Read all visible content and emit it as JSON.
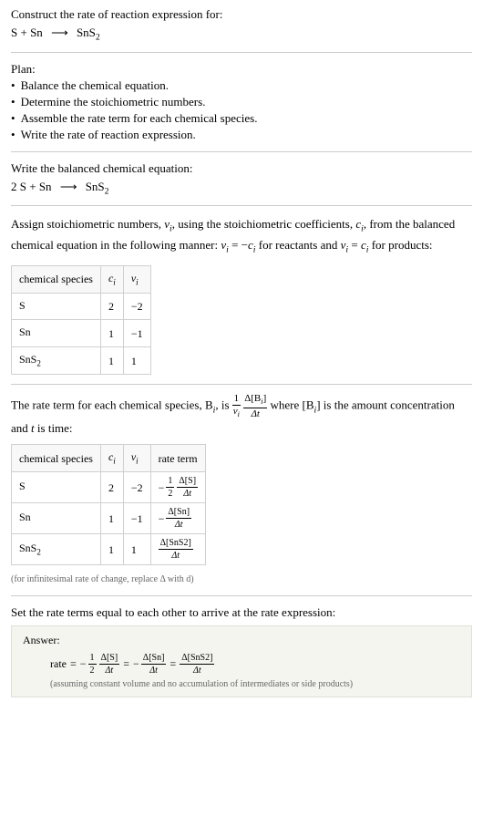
{
  "intro": {
    "line1": "Construct the rate of reaction expression for:",
    "equation_lhs1": "S",
    "equation_lhs2": "Sn",
    "equation_rhs": "SnS",
    "equation_rhs_sub": "2"
  },
  "plan": {
    "title": "Plan:",
    "items": [
      "Balance the chemical equation.",
      "Determine the stoichiometric numbers.",
      "Assemble the rate term for each chemical species.",
      "Write the rate of reaction expression."
    ]
  },
  "balanced": {
    "title": "Write the balanced chemical equation:",
    "coef1": "2",
    "sp1": "S",
    "sp2": "Sn",
    "sp3": "SnS",
    "sp3_sub": "2"
  },
  "stoich": {
    "text1": "Assign stoichiometric numbers, ",
    "nu_i": "ν",
    "sub_i": "i",
    "text2": ", using the stoichiometric coefficients, ",
    "c_i": "c",
    "text3": ", from the balanced chemical equation in the following manner: ",
    "rel1_lhs": "ν",
    "rel1_rhs_pre": " = −",
    "rel1_rhs": "c",
    "text4": " for reactants and ",
    "rel2_lhs": "ν",
    "rel2_rhs_pre": " = ",
    "rel2_rhs": "c",
    "text5": " for products:",
    "table": {
      "h1": "chemical species",
      "h2": "c",
      "h2_sub": "i",
      "h3": "ν",
      "h3_sub": "i",
      "rows": [
        {
          "sp": "S",
          "sub": "",
          "c": "2",
          "nu": "−2"
        },
        {
          "sp": "Sn",
          "sub": "",
          "c": "1",
          "nu": "−1"
        },
        {
          "sp": "SnS",
          "sub": "2",
          "c": "1",
          "nu": "1"
        }
      ]
    }
  },
  "rateterm": {
    "text1": "The rate term for each chemical species, B",
    "sub_i": "i",
    "text2": ", is ",
    "frac1_num": "1",
    "frac1_den_sym": "ν",
    "frac1_den_sub": "i",
    "frac2_num_pre": "Δ[B",
    "frac2_num_sub": "i",
    "frac2_num_post": "]",
    "frac2_den": "Δt",
    "text3": " where [B",
    "text4": "] is the amount concentration and ",
    "t": "t",
    "text5": " is time:",
    "table": {
      "h1": "chemical species",
      "h2": "c",
      "h2_sub": "i",
      "h3": "ν",
      "h3_sub": "i",
      "h4": "rate term",
      "rows": [
        {
          "sp": "S",
          "sub": "",
          "c": "2",
          "nu": "−2",
          "rate_neg": "−",
          "rate_coef_num": "1",
          "rate_coef_den": "2",
          "rate_dnum": "Δ[S]",
          "rate_dden": "Δt"
        },
        {
          "sp": "Sn",
          "sub": "",
          "c": "1",
          "nu": "−1",
          "rate_neg": "−",
          "rate_coef_num": "",
          "rate_coef_den": "",
          "rate_dnum": "Δ[Sn]",
          "rate_dden": "Δt"
        },
        {
          "sp": "SnS",
          "sub": "2",
          "c": "1",
          "nu": "1",
          "rate_neg": "",
          "rate_coef_num": "",
          "rate_coef_den": "",
          "rate_dnum": "Δ[SnS2]",
          "rate_dden": "Δt"
        }
      ]
    },
    "note": "(for infinitesimal rate of change, replace Δ with d)"
  },
  "final": {
    "title": "Set the rate terms equal to each other to arrive at the rate expression:",
    "answer_label": "Answer:",
    "rate_word": "rate",
    "eq": " = ",
    "neg": "−",
    "coef1_num": "1",
    "coef1_den": "2",
    "term1_num": "Δ[S]",
    "term1_den": "Δt",
    "term2_num": "Δ[Sn]",
    "term2_den": "Δt",
    "term3_num": "Δ[SnS2]",
    "term3_den": "Δt",
    "note": "(assuming constant volume and no accumulation of intermediates or side products)"
  }
}
